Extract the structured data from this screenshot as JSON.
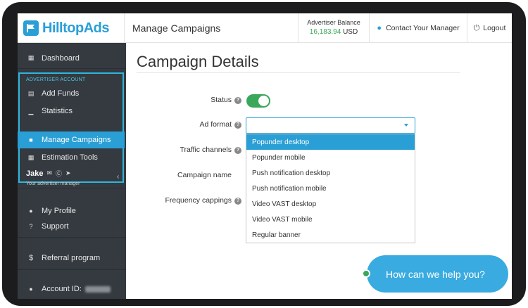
{
  "app": {
    "logo_text": "HilltopAds"
  },
  "header": {
    "page_title": "Manage Campaigns",
    "balance_label": "Advertiser Balance",
    "balance_amount": "16,183.94",
    "balance_currency": "USD",
    "contact_label": "Contact Your Manager",
    "logout_label": "Logout"
  },
  "sidebar": {
    "dashboard": "Dashboard",
    "section_title": "ADVERTISER ACCOUNT",
    "items": [
      {
        "label": "Add Funds",
        "icon": "card-icon"
      },
      {
        "label": "Statistics",
        "icon": "chart-icon"
      },
      {
        "label": "Manage Campaigns",
        "icon": "briefcase-icon",
        "active": true
      },
      {
        "label": "Estimation Tools",
        "icon": "calculator-icon"
      }
    ],
    "manager_name": "Jake",
    "manager_subtitle": "Your advertiser manager",
    "my_profile": "My Profile",
    "support": "Support",
    "referral": "Referral program",
    "account_id_label": "Account ID:"
  },
  "main": {
    "title": "Campaign Details",
    "status_label": "Status",
    "status_on": true,
    "ad_format_label": "Ad format",
    "ad_format_value": "",
    "traffic_channels_label": "Traffic channels",
    "campaign_name_label": "Campaign name",
    "frequency_label": "Frequency cappings",
    "ad_format_options": [
      "Popunder desktop",
      "Popunder mobile",
      "Push notification desktop",
      "Push notification mobile",
      "Video VAST desktop",
      "Video VAST mobile",
      "Regular banner"
    ],
    "selected_option": "Popunder desktop"
  },
  "chat": {
    "prompt": "How can we help you?"
  },
  "colors": {
    "accent": "#2a9fd6",
    "sidebar_bg": "#343a40",
    "success": "#3aa75a",
    "chat_bg": "#39abe0"
  }
}
